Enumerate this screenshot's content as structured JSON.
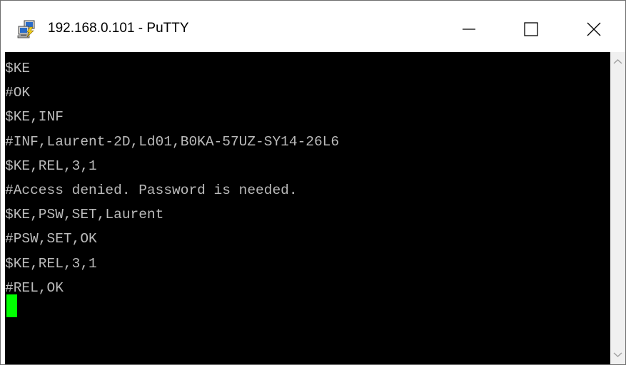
{
  "window": {
    "title": "192.168.0.101 - PuTTY",
    "app_icon": "putty-icon",
    "controls": {
      "minimize_icon": "minimize-icon",
      "maximize_icon": "maximize-icon",
      "close_icon": "close-icon"
    }
  },
  "terminal": {
    "background": "#000000",
    "text_color": "#bbbbbb",
    "cursor_color": "#00ff00",
    "lines": [
      "$KE",
      "#OK",
      "$KE,INF",
      "#INF,Laurent-2D,Ld01,B0KA-57UZ-SY14-26L6",
      "$KE,REL,3,1",
      "#Access denied. Password is needed.",
      "$KE,PSW,SET,Laurent",
      "#PSW,SET,OK",
      "$KE,REL,3,1",
      "#REL,OK"
    ]
  },
  "scrollbar": {
    "up_icon": "scroll-up-arrow-icon",
    "down_icon": "scroll-down-arrow-icon"
  }
}
